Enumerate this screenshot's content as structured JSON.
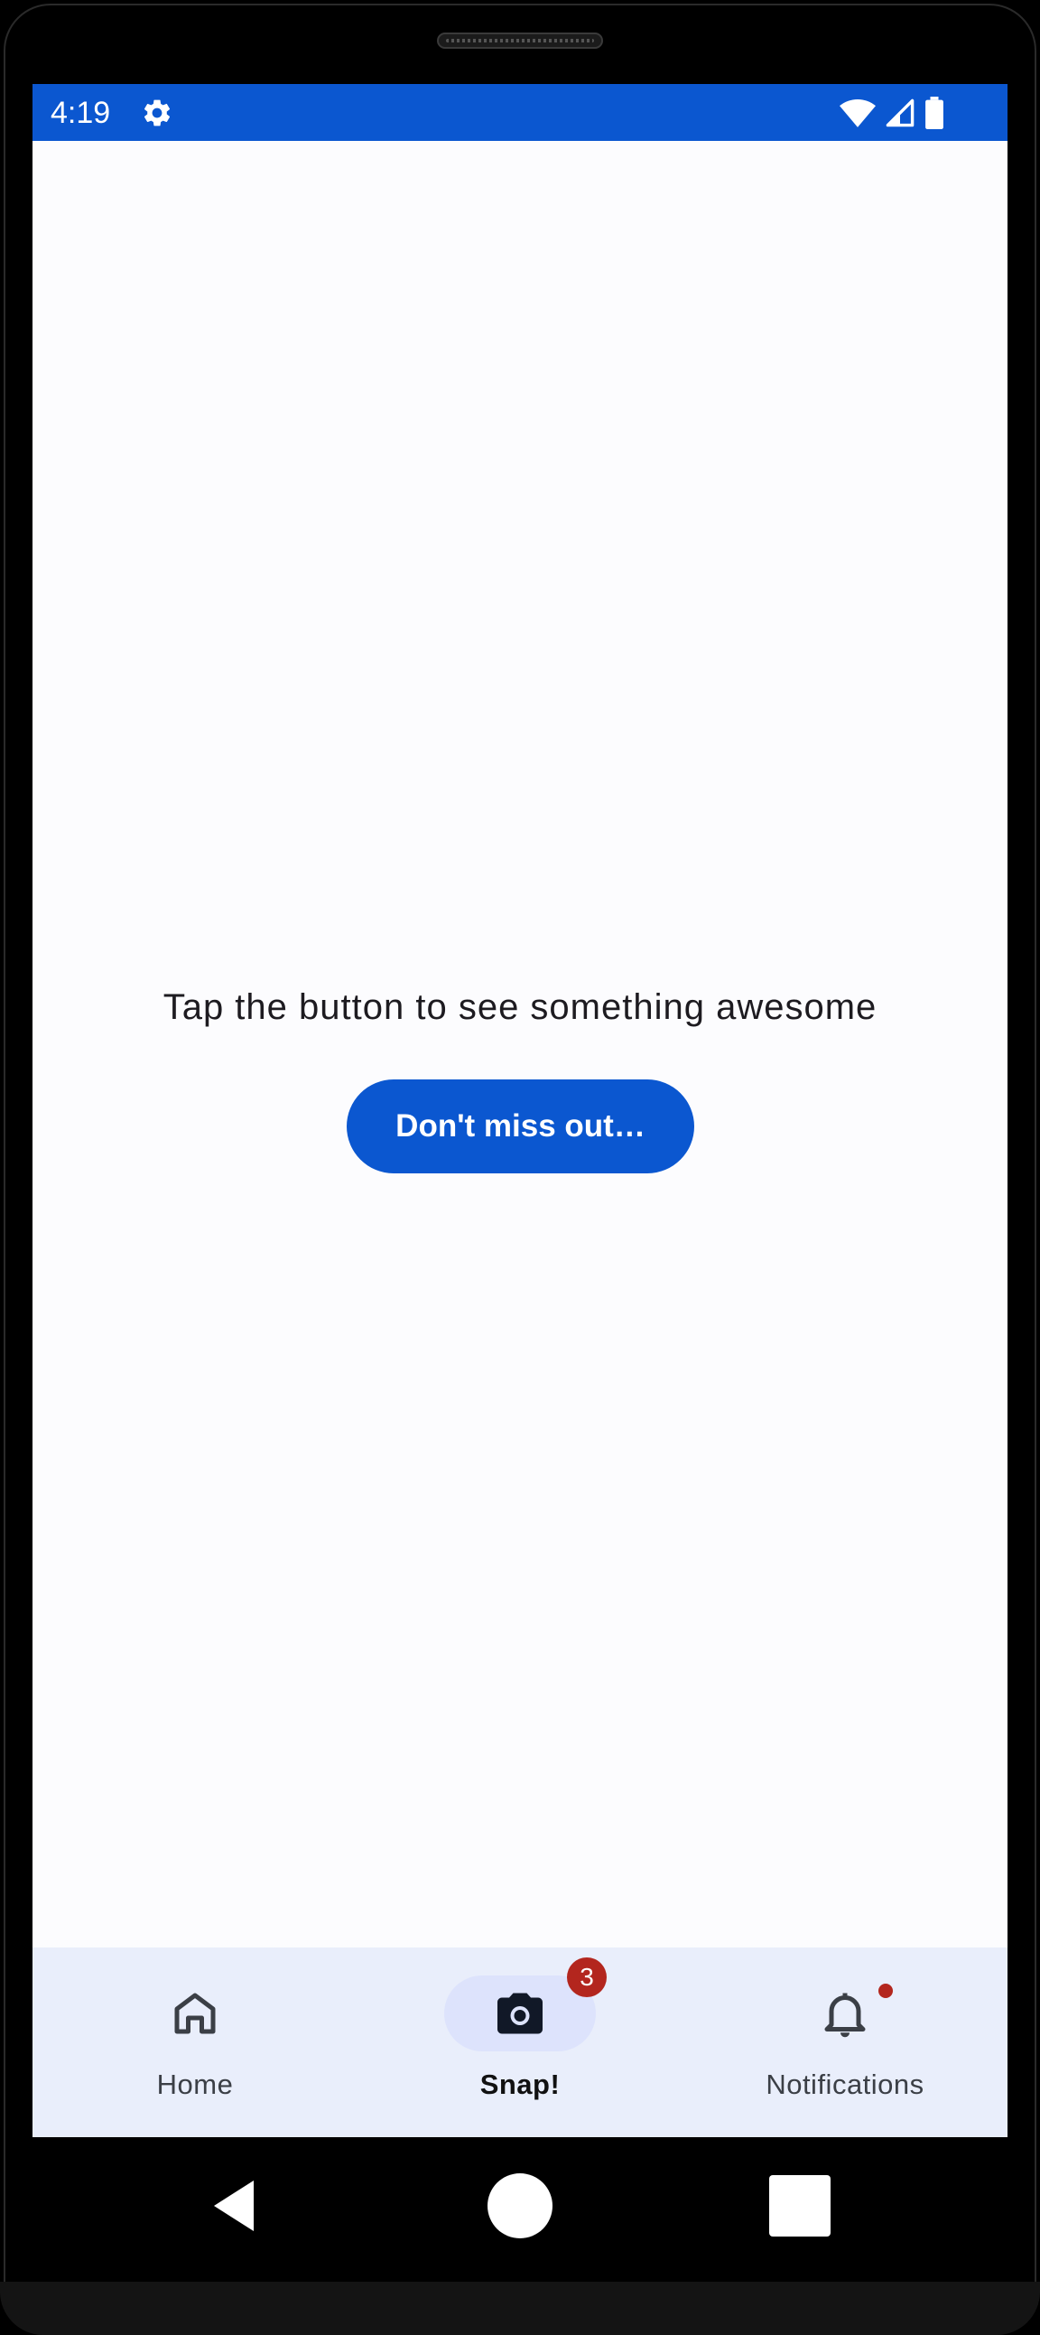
{
  "status_bar": {
    "time": "4:19",
    "settings_icon": "gear-icon",
    "wifi_icon": "wifi-icon",
    "signal_icon": "signal-icon",
    "battery_icon": "battery-icon",
    "color": "#0b57d0"
  },
  "main": {
    "prompt": "Tap the button to see something awesome",
    "button_label": "Don't miss out…"
  },
  "bottom_nav": {
    "items": [
      {
        "label": "Home",
        "icon": "home-icon",
        "selected": false
      },
      {
        "label": "Snap!",
        "icon": "camera-icon",
        "selected": true,
        "badge": "3"
      },
      {
        "label": "Notifications",
        "icon": "bell-icon",
        "selected": false,
        "badge_dot": true
      }
    ],
    "background": "#e9eefb",
    "indicator_color": "#dde3fc",
    "badge_color": "#b3261e"
  },
  "system_nav": {
    "back_icon": "back-triangle-icon",
    "home_icon": "home-circle-icon",
    "recents_icon": "recents-square-icon"
  }
}
